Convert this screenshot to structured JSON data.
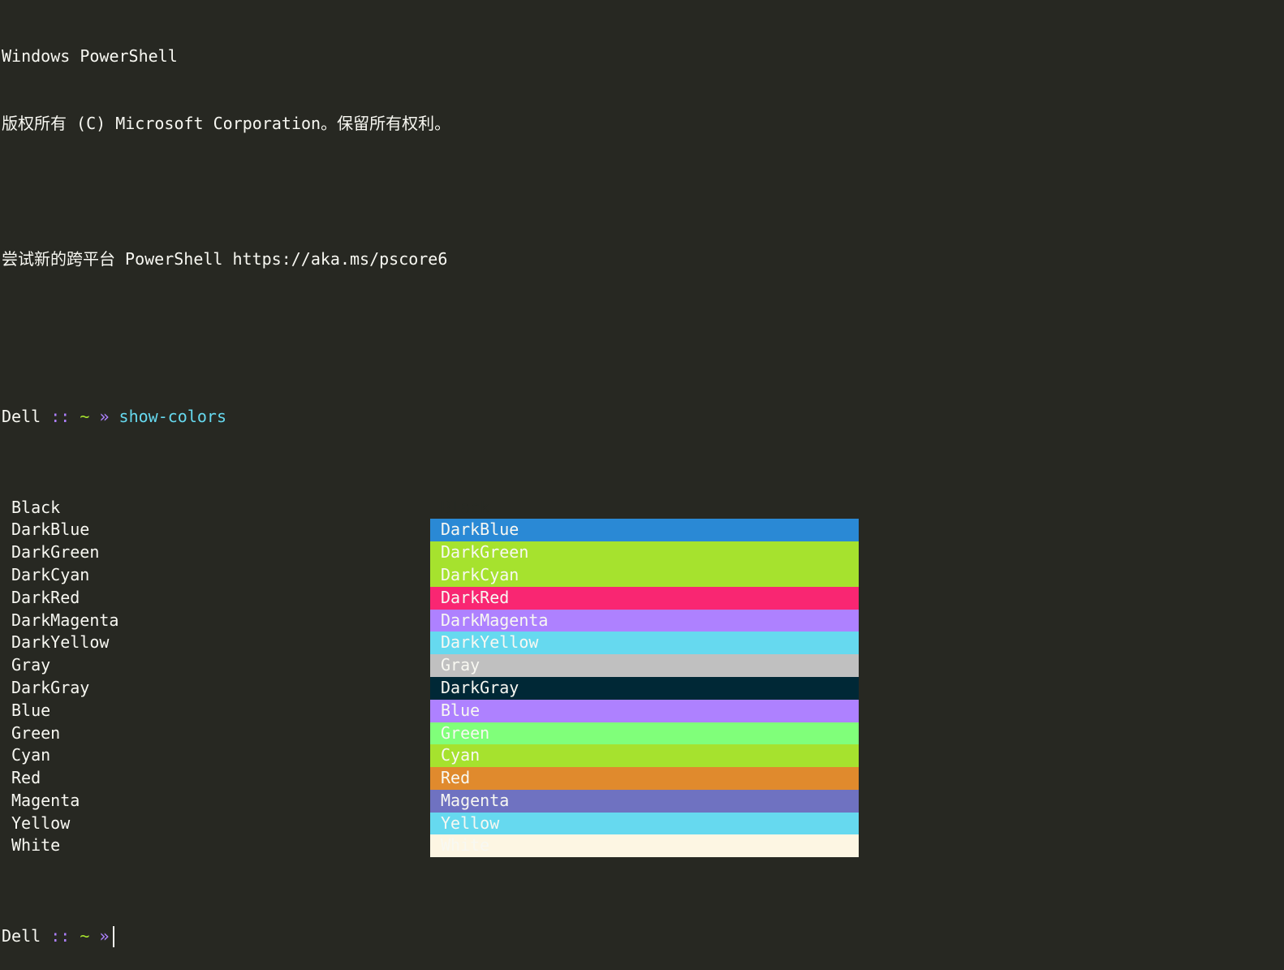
{
  "header": {
    "line1": "Windows PowerShell",
    "line2": "版权所有 (C) Microsoft Corporation。保留所有权利。",
    "line3": "",
    "line4": "尝试新的跨平台 PowerShell https://aka.ms/pscore6",
    "line5": ""
  },
  "prompt": {
    "host": "Dell",
    "colons": "::",
    "tilde": "~",
    "arrow": "»",
    "command": "show-colors"
  },
  "colors": [
    {
      "name": "Black",
      "fg": "#272822",
      "bg": "#272822",
      "fg_display": "#f8f8f2"
    },
    {
      "name": "DarkBlue",
      "fg": "#f8f8f2",
      "bg": "#2a89d5"
    },
    {
      "name": "DarkGreen",
      "fg": "#f8f8f2",
      "bg": "#a6e22e"
    },
    {
      "name": "DarkCyan",
      "fg": "#f8f8f2",
      "bg": "#a6e22e"
    },
    {
      "name": "DarkRed",
      "fg": "#f8f8f2",
      "bg": "#f92672"
    },
    {
      "name": "DarkMagenta",
      "fg": "#f8f8f2",
      "bg": "#ae81ff"
    },
    {
      "name": "DarkYellow",
      "fg": "#f8f8f2",
      "bg": "#66d9ef"
    },
    {
      "name": "Gray",
      "fg": "#f8f8f2",
      "bg": "#c0c0c0"
    },
    {
      "name": "DarkGray",
      "fg": "#f8f8f2",
      "bg": "#002836"
    },
    {
      "name": "Blue",
      "fg": "#f8f8f2",
      "bg": "#ae81ff"
    },
    {
      "name": "Green",
      "fg": "#f8f8f2",
      "bg": "#80ff7a"
    },
    {
      "name": "Cyan",
      "fg": "#f8f8f2",
      "bg": "#a6e22e"
    },
    {
      "name": "Red",
      "fg": "#f8f8f2",
      "bg": "#e08a2d"
    },
    {
      "name": "Magenta",
      "fg": "#f8f8f2",
      "bg": "#6f72c1"
    },
    {
      "name": "Yellow",
      "fg": "#f8f8f2",
      "bg": "#66d9ef"
    },
    {
      "name": "White",
      "fg": "#f8f8f2",
      "bg": "#fdf6e3"
    }
  ],
  "theme": {
    "background": "#272822",
    "foreground": "#f8f8f2"
  }
}
